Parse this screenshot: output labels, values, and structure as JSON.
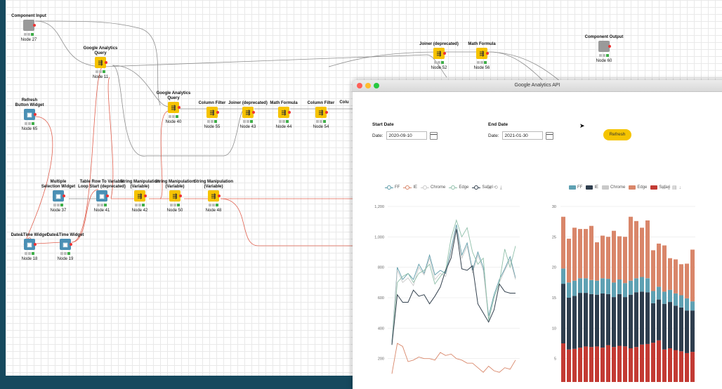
{
  "workflow": {
    "nodes": [
      {
        "id": "n27",
        "title": "Component Input",
        "label": "Node 27",
        "kind": "gray-in"
      },
      {
        "id": "n11",
        "title": "Google Analytics\nQuery",
        "label": "Node 11",
        "kind": "yellow"
      },
      {
        "id": "n65",
        "title": "Refresh\nButton Widget",
        "label": "Node 65",
        "kind": "blue"
      },
      {
        "id": "n40",
        "title": "Google Analytics\nQuery",
        "label": "Node 40",
        "kind": "yellow"
      },
      {
        "id": "n55",
        "title": "Column Filter",
        "label": "Node 55",
        "kind": "yellow"
      },
      {
        "id": "n43",
        "title": "Joiner (deprecated)",
        "label": "Node 43",
        "kind": "yellow"
      },
      {
        "id": "n44",
        "title": "Math Formula",
        "label": "Node 44",
        "kind": "yellow"
      },
      {
        "id": "n54",
        "title": "Column Filter",
        "label": "Node 54",
        "kind": "yellow"
      },
      {
        "id": "n52",
        "title": "Joiner (deprecated)",
        "label": "Node 52",
        "kind": "yellow"
      },
      {
        "id": "n56",
        "title": "Math Formula",
        "label": "Node 56",
        "kind": "yellow"
      },
      {
        "id": "n60",
        "title": "Component Output",
        "label": "Node 60",
        "kind": "gray-out"
      },
      {
        "id": "n37",
        "title": "Multiple\nSelection Widget",
        "label": "Node 37",
        "kind": "blue"
      },
      {
        "id": "n41",
        "title": "Table Row To Variable\nLoop Start (deprecated)",
        "label": "Node 41",
        "kind": "blue"
      },
      {
        "id": "n42",
        "title": "String Manipulation\n(Variable)",
        "label": "Node 42",
        "kind": "yellow"
      },
      {
        "id": "n50",
        "title": "String Manipulation\n(Variable)",
        "label": "Node 50",
        "kind": "yellow"
      },
      {
        "id": "n48",
        "title": "String Manipulation\n(Variable)",
        "label": "Node 48",
        "kind": "yellow"
      },
      {
        "id": "n18",
        "title": "Date&Time Widget",
        "label": "Node 18",
        "kind": "blue"
      },
      {
        "id": "n19",
        "title": "Date&Time Widget",
        "label": "Node 19",
        "kind": "blue"
      }
    ],
    "partial_label": "Colu"
  },
  "dialog": {
    "title": "Google Analytics API",
    "start_date": {
      "heading": "Start Date",
      "prefix": "Date:",
      "value": "2020-09-10"
    },
    "end_date": {
      "heading": "End Date",
      "prefix": "Date:",
      "value": "2021-01-30"
    },
    "refresh_label": "Refresh"
  },
  "colors": {
    "FF": "#5b9aa8",
    "IE": "#d9876a",
    "Chrome": "#c9c9c9",
    "Edge": "#8fbfa9",
    "Safari": "#33414e",
    "Edge_bar": "#d9866a",
    "Safari_bar": "#c33b34",
    "FF_bar": "#5fa1b3",
    "IE_bar": "#2f3e4e",
    "node_yellow": "#f6c300",
    "node_blue": "#4a8fb4",
    "wire_red": "#e0604f"
  },
  "chart_data": [
    {
      "type": "line",
      "legend": [
        "FF",
        "IE",
        "Chrome",
        "Edge",
        "Safari"
      ],
      "y_ticks": [
        "200",
        "400",
        "600",
        "800",
        "1,000",
        "1,200"
      ],
      "ylim": [
        0,
        1200
      ],
      "series": [
        {
          "name": "FF",
          "values": [
            310,
            800,
            720,
            760,
            720,
            820,
            760,
            880,
            750,
            780,
            760,
            920,
            1080,
            880,
            960,
            780,
            900,
            800,
            480,
            620,
            720,
            790,
            870,
            730
          ]
        },
        {
          "name": "IE",
          "values": [
            100,
            300,
            280,
            180,
            190,
            210,
            200,
            200,
            190,
            240,
            220,
            230,
            200,
            190,
            170,
            170,
            140,
            110,
            150,
            120,
            110,
            140,
            130,
            190
          ]
        },
        {
          "name": "Chrome",
          "values": [
            300,
            780,
            700,
            730,
            680,
            800,
            750,
            860,
            720,
            760,
            740,
            900,
            1060,
            860,
            940,
            760,
            880,
            780,
            460,
            600,
            700,
            780,
            850,
            720
          ]
        },
        {
          "name": "Edge",
          "values": [
            290,
            700,
            740,
            760,
            700,
            760,
            780,
            820,
            690,
            740,
            780,
            990,
            1110,
            1000,
            1060,
            900,
            820,
            860,
            450,
            600,
            700,
            920,
            800,
            940
          ]
        },
        {
          "name": "Safari",
          "values": [
            290,
            620,
            570,
            570,
            650,
            610,
            620,
            560,
            610,
            670,
            780,
            860,
            1050,
            790,
            780,
            810,
            560,
            500,
            440,
            520,
            690,
            640,
            630,
            630
          ]
        }
      ]
    },
    {
      "type": "bar",
      "legend": [
        "FF",
        "IE",
        "Chrome",
        "Edge",
        "Safari"
      ],
      "y_ticks": [
        "5",
        "10",
        "15",
        "20",
        "25",
        "30"
      ],
      "ylim": [
        0,
        30
      ],
      "series": [
        {
          "name": "Safari",
          "values": [
            7.5,
            6.5,
            6.6,
            6.8,
            7.0,
            6.9,
            7.0,
            6.8,
            7.2,
            6.9,
            7.1,
            7.0,
            6.7,
            6.9,
            7.3,
            7.4,
            7.6,
            8.0,
            6.5,
            6.7,
            6.4,
            6.2,
            5.9,
            6.1
          ]
        },
        {
          "name": "IE",
          "values": [
            9.8,
            8.5,
            8.7,
            9.0,
            8.8,
            8.7,
            8.5,
            8.9,
            8.4,
            8.2,
            8.5,
            8.1,
            8.8,
            9.0,
            8.7,
            8.5,
            6.5,
            6.7,
            7.5,
            7.6,
            7.3,
            7.2,
            7.0,
            6.8
          ]
        },
        {
          "name": "FF",
          "values": [
            2.5,
            2.5,
            2.5,
            2.4,
            2.4,
            2.3,
            2.3,
            2.5,
            2.5,
            2.4,
            2.4,
            2.3,
            2.3,
            2.3,
            2.4,
            2.3,
            2.0,
            2.1,
            2.0,
            2.0,
            2.0,
            2.0,
            2.0,
            1.5
          ]
        },
        {
          "name": "Edge",
          "values": [
            8.5,
            7.2,
            8.7,
            8.1,
            8.1,
            8.9,
            6.3,
            7.0,
            6.9,
            8.5,
            7.1,
            7.6,
            10.5,
            9.4,
            8.1,
            9.5,
            6.7,
            7.1,
            7.6,
            5.2,
            5.6,
            5.1,
            5.7,
            8.5
          ]
        }
      ]
    }
  ]
}
